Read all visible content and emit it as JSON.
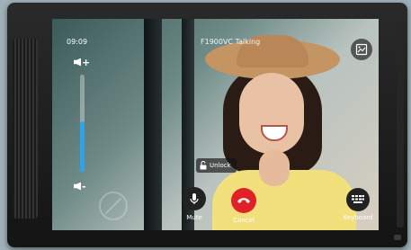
{
  "status_bar": {
    "time": "09:09",
    "call_status": "F1900VC Talking"
  },
  "volume": {
    "up_label": "+",
    "down_label": "-",
    "level_fraction": 0.52,
    "accent_color": "#2da3ea"
  },
  "controls": {
    "mute_label": "Mute",
    "unlock_label": "Unlock",
    "cancel_label": "Cancel",
    "keyboard_label": "Keyboard"
  },
  "icons": {
    "snapshot": "snapshot-icon",
    "volume_up": "volume-up-icon",
    "volume_down": "volume-down-icon",
    "mute": "microphone-icon",
    "unlock": "unlock-icon",
    "cancel": "hangup-icon",
    "keyboard": "keypad-icon"
  },
  "colors": {
    "cancel": "#e02128",
    "button_dark": "#222222"
  }
}
